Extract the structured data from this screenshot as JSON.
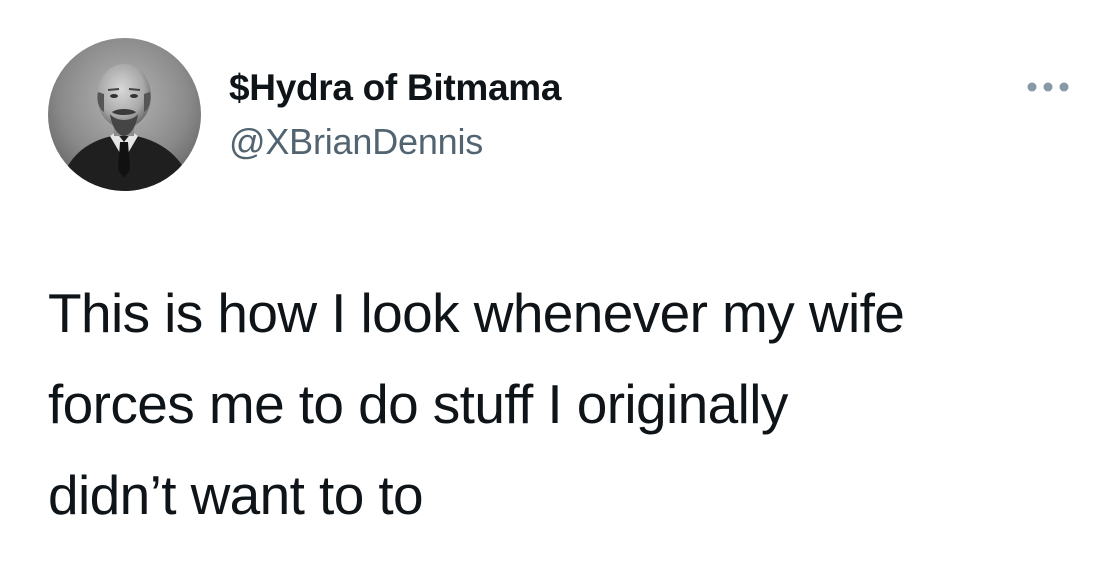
{
  "tweet": {
    "author": {
      "display_name": "$Hydra of Bitmama",
      "handle": "@XBrianDennis",
      "avatar": "profile-photo"
    },
    "more_icon": "more-horizontal-icon",
    "text_lines": [
      "This is how I look whenever my wife",
      "forces me to do stuff I originally",
      "didn’t want to to"
    ],
    "colors": {
      "text": "#0f1419",
      "handle": "#536471",
      "more_icon": "#8899a6",
      "background": "#ffffff"
    }
  }
}
